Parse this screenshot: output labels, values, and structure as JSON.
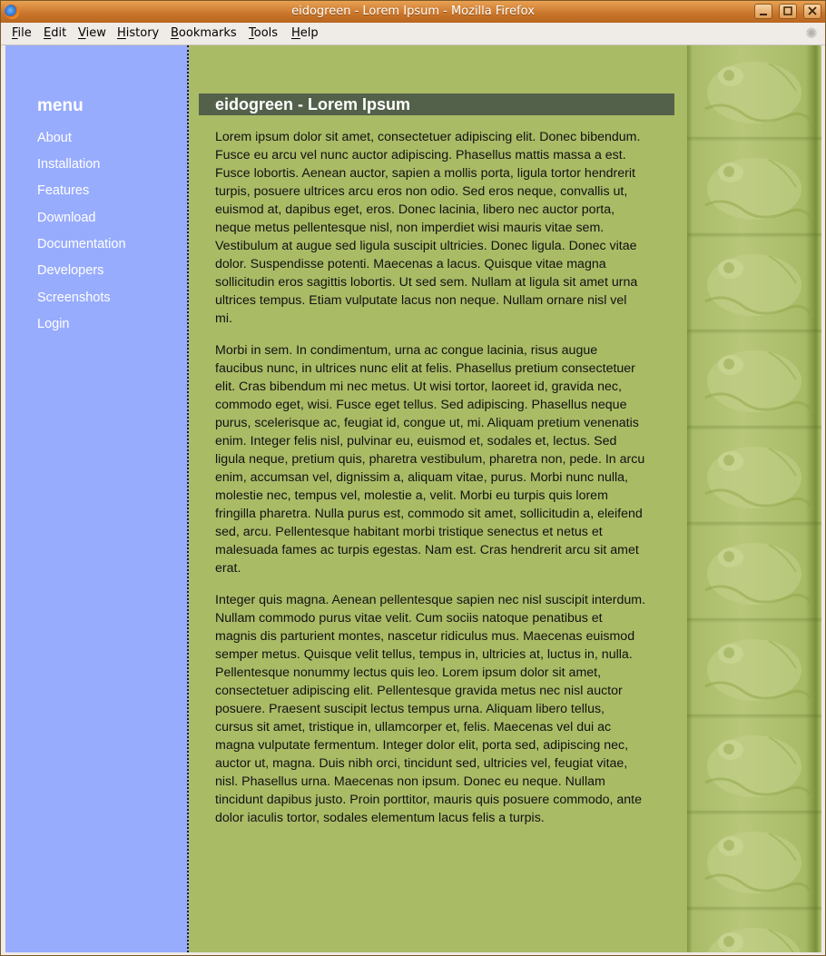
{
  "window": {
    "title": "eidogreen - Lorem Ipsum - Mozilla Firefox",
    "controls": [
      "minimize",
      "maximize",
      "close"
    ]
  },
  "menubar": {
    "items": [
      "File",
      "Edit",
      "View",
      "History",
      "Bookmarks",
      "Tools",
      "Help"
    ]
  },
  "sidebar": {
    "heading": "menu",
    "links": [
      "About",
      "Installation",
      "Features",
      "Download",
      "Documentation",
      "Developers",
      "Screenshots",
      "Login"
    ]
  },
  "content": {
    "heading": "eidogreen - Lorem Ipsum",
    "paragraphs": [
      "Lorem ipsum dolor sit amet, consectetuer adipiscing elit. Donec bibendum. Fusce eu arcu vel nunc auctor adipiscing. Phasellus mattis massa a est. Fusce lobortis. Aenean auctor, sapien a mollis porta, ligula tortor hendrerit turpis, posuere ultrices arcu eros non odio. Sed eros neque, convallis ut, euismod at, dapibus eget, eros. Donec lacinia, libero nec auctor porta, neque metus pellentesque nisl, non imperdiet wisi mauris vitae sem. Vestibulum at augue sed ligula suscipit ultricies. Donec ligula. Donec vitae dolor. Suspendisse potenti. Maecenas a lacus. Quisque vitae magna sollicitudin eros sagittis lobortis. Ut sed sem. Nullam at ligula sit amet urna ultrices tempus. Etiam vulputate lacus non neque. Nullam ornare nisl vel mi.",
      "Morbi in sem. In condimentum, urna ac congue lacinia, risus augue faucibus nunc, in ultrices nunc elit at felis. Phasellus pretium consectetuer elit. Cras bibendum mi nec metus. Ut wisi tortor, laoreet id, gravida nec, commodo eget, wisi. Fusce eget tellus. Sed adipiscing. Phasellus neque purus, scelerisque ac, feugiat id, congue ut, mi. Aliquam pretium venenatis enim. Integer felis nisl, pulvinar eu, euismod et, sodales et, lectus. Sed ligula neque, pretium quis, pharetra vestibulum, pharetra non, pede. In arcu enim, accumsan vel, dignissim a, aliquam vitae, purus. Morbi nunc nulla, molestie nec, tempus vel, molestie a, velit. Morbi eu turpis quis lorem fringilla pharetra. Nulla purus est, commodo sit amet, sollicitudin a, eleifend sed, arcu. Pellentesque habitant morbi tristique senectus et netus et malesuada fames ac turpis egestas. Nam est. Cras hendrerit arcu sit amet erat.",
      "Integer quis magna. Aenean pellentesque sapien nec nisl suscipit interdum. Nullam commodo purus vitae velit. Cum sociis natoque penatibus et magnis dis parturient montes, nascetur ridiculus mus. Maecenas euismod semper metus. Quisque velit tellus, tempus in, ultricies at, luctus in, nulla. Pellentesque nonummy lectus quis leo. Lorem ipsum dolor sit amet, consectetuer adipiscing elit. Pellentesque gravida metus nec nisl auctor posuere. Praesent suscipit lectus tempus urna. Aliquam libero tellus, cursus sit amet, tristique in, ullamcorper et, felis. Maecenas vel dui ac magna vulputate fermentum. Integer dolor elit, porta sed, adipiscing nec, auctor ut, magna. Duis nibh orci, tincidunt sed, ultricies vel, feugiat vitae, nisl. Phasellus urna. Maecenas non ipsum. Donec eu neque. Nullam tincidunt dapibus justo. Proin porttitor, mauris quis posuere commodo, ante dolor iaculis tortor, sodales elementum lacus felis a turpis."
    ]
  },
  "colors": {
    "sidebar_bg": "#98acfe",
    "content_bg": "#aabb66",
    "heading_bar": "#53614a",
    "titlebar": "#c8742a"
  },
  "icons": {
    "app": "firefox-icon",
    "throbber": "throbber-icon",
    "decoration": "frog-pattern"
  }
}
